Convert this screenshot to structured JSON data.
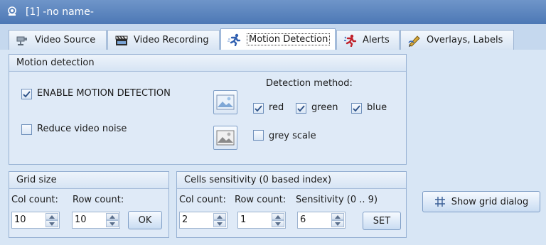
{
  "window": {
    "title": "[1] -no name-"
  },
  "tabs": [
    {
      "label": "Video Source",
      "icon": "camera-icon"
    },
    {
      "label": "Video Recording",
      "icon": "clapperboard-icon"
    },
    {
      "label": "Motion Detection",
      "icon": "running-person-icon",
      "active": true
    },
    {
      "label": "Alerts",
      "icon": "alert-person-icon"
    },
    {
      "label": "Overlays, Labels",
      "icon": "pen-icon"
    }
  ],
  "motion_detection": {
    "group_title": "Motion detection",
    "enable_label": "ENABLE MOTION DETECTION",
    "enable_checked": true,
    "noise_label": "Reduce video noise",
    "noise_checked": false,
    "method_title": "Detection method:",
    "red_label": "red",
    "red_checked": true,
    "green_label": "green",
    "green_checked": true,
    "blue_label": "blue",
    "blue_checked": true,
    "grey_label": "grey scale",
    "grey_checked": false
  },
  "grid_size": {
    "group_title": "Grid size",
    "col_label": "Col count:",
    "row_label": "Row count:",
    "col_value": "10",
    "row_value": "10",
    "ok_label": "OK"
  },
  "cells_sensitivity": {
    "group_title": "Cells sensitivity  (0 based index)",
    "col_label": "Col count:",
    "row_label": "Row count:",
    "sens_label": "Sensitivity (0 .. 9)",
    "col_value": "2",
    "row_value": "1",
    "sens_value": "6",
    "set_label": "SET"
  },
  "grid_dialog_button": {
    "label": "Show grid dialog",
    "icon": "grid-icon"
  }
}
